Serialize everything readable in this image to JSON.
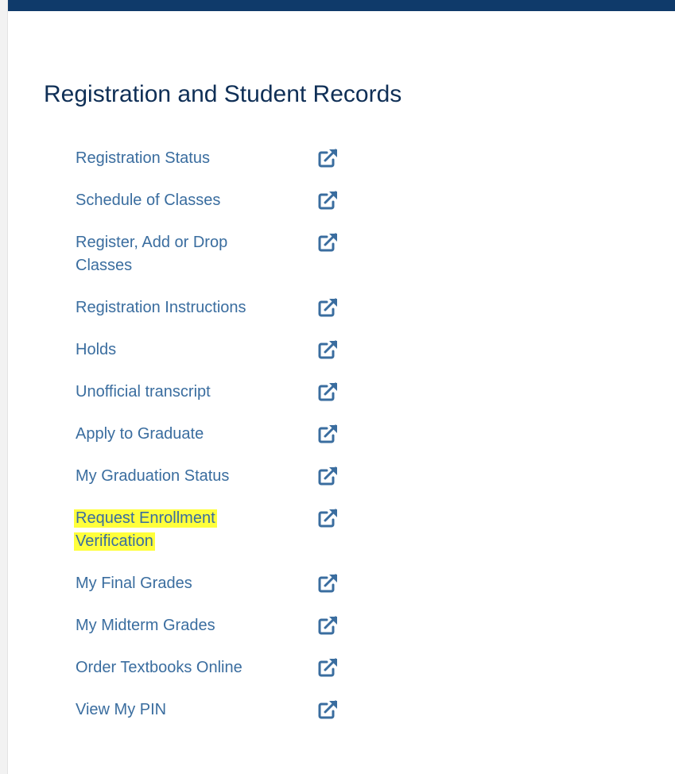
{
  "section": {
    "title": "Registration and Student Records"
  },
  "links": [
    {
      "label": "Registration Status",
      "icon": "external-link-icon",
      "highlighted": false
    },
    {
      "label": "Schedule of Classes",
      "icon": "external-link-icon",
      "highlighted": false
    },
    {
      "label": "Register, Add or Drop Classes",
      "icon": "external-link-icon",
      "highlighted": false
    },
    {
      "label": "Registration Instructions",
      "icon": "external-link-icon",
      "highlighted": false
    },
    {
      "label": "Holds",
      "icon": "external-link-icon",
      "highlighted": false
    },
    {
      "label": "Unofficial transcript",
      "icon": "external-link-icon",
      "highlighted": false
    },
    {
      "label": "Apply to Graduate",
      "icon": "external-link-icon",
      "highlighted": false
    },
    {
      "label": "My Graduation Status",
      "icon": "external-link-icon",
      "highlighted": false
    },
    {
      "label": "Request Enrollment Verification",
      "icon": "external-link-icon",
      "highlighted": true
    },
    {
      "label": "My Final Grades",
      "icon": "external-link-icon",
      "highlighted": false
    },
    {
      "label": "My Midterm Grades",
      "icon": "external-link-icon",
      "highlighted": false
    },
    {
      "label": "Order Textbooks Online",
      "icon": "external-link-icon",
      "highlighted": false
    },
    {
      "label": "View My PIN",
      "icon": "external-link-icon",
      "highlighted": false
    }
  ],
  "colors": {
    "top_bar": "#0f3a6a",
    "title": "#0f2f56",
    "link": "#3a6d9f",
    "highlight": "#ffff3b"
  }
}
